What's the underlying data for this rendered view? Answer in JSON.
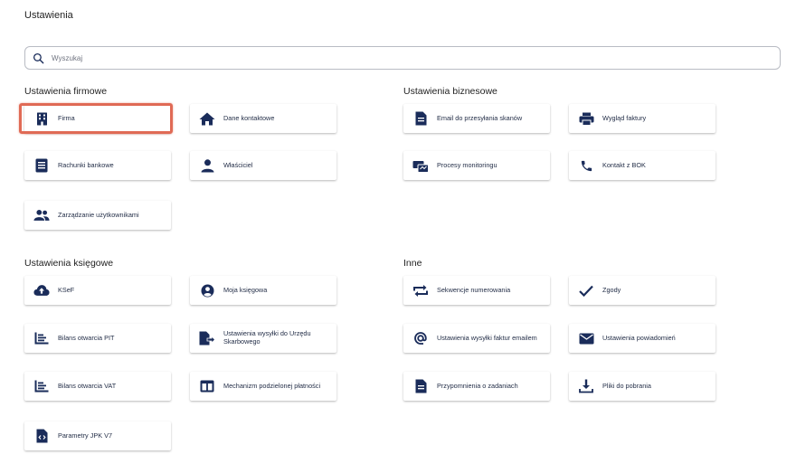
{
  "page": {
    "title": "Ustawienia"
  },
  "search": {
    "placeholder": "Wyszukaj"
  },
  "colors": {
    "icon": "#1a2c5a",
    "highlight": "#e06a55"
  },
  "sections": {
    "firmowe": {
      "title": "Ustawienia firmowe",
      "items": [
        {
          "label": "Firma",
          "icon": "building-icon"
        },
        {
          "label": "Dane kontaktowe",
          "icon": "home-icon"
        },
        {
          "label": "Rachunki bankowe",
          "icon": "bank-account-icon"
        },
        {
          "label": "Właściciel",
          "icon": "person-icon"
        },
        {
          "label": "Zarządzanie użytkownikami",
          "icon": "users-icon"
        }
      ]
    },
    "biznesowe": {
      "title": "Ustawienia biznesowe",
      "items": [
        {
          "label": "Email do przesyłania skanów",
          "icon": "document-icon"
        },
        {
          "label": "Wygląd faktury",
          "icon": "printer-icon"
        },
        {
          "label": "Procesy monitoringu",
          "icon": "monitoring-icon"
        },
        {
          "label": "Kontakt z BOK",
          "icon": "phone-icon"
        }
      ]
    },
    "ksiegowe": {
      "title": "Ustawienia księgowe",
      "items": [
        {
          "label": "KSeF",
          "icon": "cloud-upload-icon"
        },
        {
          "label": "Moja księgowa",
          "icon": "account-circle-icon"
        },
        {
          "label": "Bilans otwarcia PIT",
          "icon": "balance-list-icon"
        },
        {
          "label": "Ustawienia wysyłki do Urzędu Skarbowego",
          "icon": "file-send-icon"
        },
        {
          "label": "Bilans otwarcia VAT",
          "icon": "balance-list-icon"
        },
        {
          "label": "Mechanizm podzielonej płatności",
          "icon": "split-payment-icon"
        },
        {
          "label": "Parametry JPK V7",
          "icon": "code-file-icon"
        }
      ]
    },
    "inne": {
      "title": "Inne",
      "items": [
        {
          "label": "Sekwencje numerowania",
          "icon": "repeat-icon"
        },
        {
          "label": "Zgody",
          "icon": "check-icon"
        },
        {
          "label": "Ustawienia wysyłki faktur emailem",
          "icon": "at-icon"
        },
        {
          "label": "Ustawienia powiadomień",
          "icon": "mail-icon"
        },
        {
          "label": "Przypomnienia o zadaniach",
          "icon": "document-icon"
        },
        {
          "label": "Pliki do pobrania",
          "icon": "download-icon"
        }
      ]
    }
  }
}
